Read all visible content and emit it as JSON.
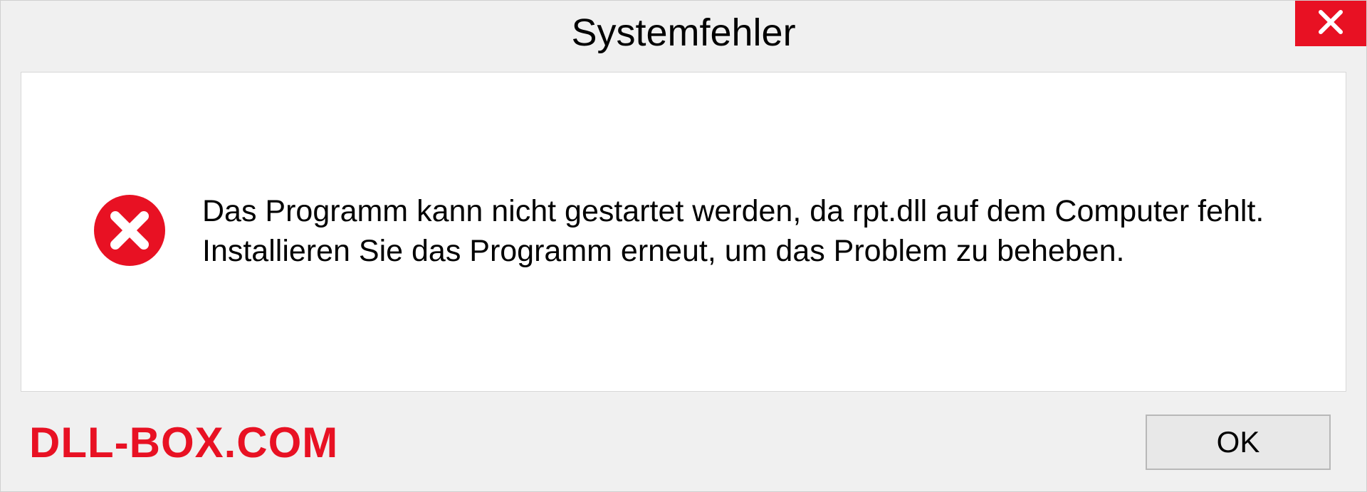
{
  "dialog": {
    "title": "Systemfehler",
    "message": "Das Programm kann nicht gestartet werden, da rpt.dll auf dem Computer fehlt. Installieren Sie das Programm erneut, um das Problem zu beheben.",
    "ok_label": "OK"
  },
  "watermark": "DLL-BOX.COM"
}
